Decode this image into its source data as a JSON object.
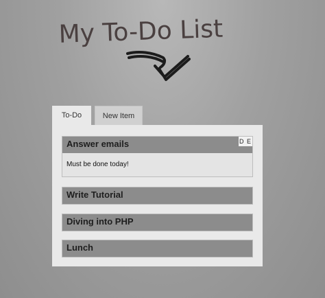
{
  "header": {
    "title": "My To-Do List"
  },
  "tabs": [
    {
      "label": "To-Do",
      "active": true
    },
    {
      "label": "New Item",
      "active": false
    }
  ],
  "items": [
    {
      "title": "Answer emails",
      "note": "Must be done today!",
      "actions": "D E",
      "expanded": true
    },
    {
      "title": "Write Tutorial",
      "expanded": false
    },
    {
      "title": "Diving into PHP",
      "expanded": false
    },
    {
      "title": "Lunch",
      "expanded": false
    }
  ],
  "colors": {
    "panel": "#e9e9e9",
    "item_header": "#8c8c8c",
    "handwriting": "#4a4040"
  },
  "icons": {
    "arrow": "hand-drawn-arrow-check-icon"
  }
}
